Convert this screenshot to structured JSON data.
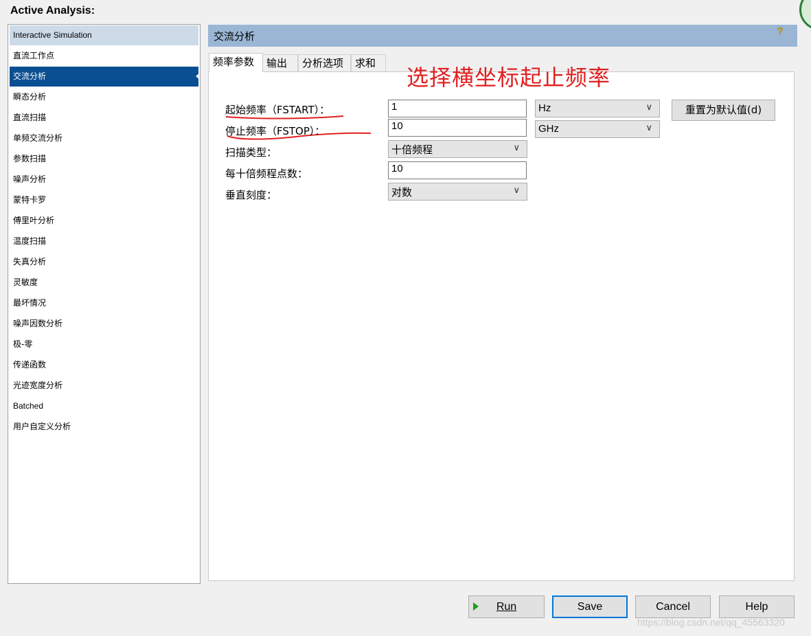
{
  "window": {
    "title": "Active Analysis:"
  },
  "sidebar": {
    "items": [
      {
        "label": "Interactive Simulation"
      },
      {
        "label": "直流工作点"
      },
      {
        "label": "交流分析"
      },
      {
        "label": "瞬态分析"
      },
      {
        "label": "直流扫描"
      },
      {
        "label": "单频交流分析"
      },
      {
        "label": "参数扫描"
      },
      {
        "label": "噪声分析"
      },
      {
        "label": "蒙特卡罗"
      },
      {
        "label": "傅里叶分析"
      },
      {
        "label": "温度扫描"
      },
      {
        "label": "失真分析"
      },
      {
        "label": "灵敏度"
      },
      {
        "label": "最坏情况"
      },
      {
        "label": "噪声因数分析"
      },
      {
        "label": "极-零"
      },
      {
        "label": "传递函数"
      },
      {
        "label": "光迹宽度分析"
      },
      {
        "label": "Batched"
      },
      {
        "label": "用户自定义分析"
      }
    ],
    "selected": "交流分析"
  },
  "panel": {
    "title": "交流分析",
    "help_icon": "?",
    "tabs": [
      {
        "label": "频率参数"
      },
      {
        "label": "输出"
      },
      {
        "label": "分析选项"
      },
      {
        "label": "求和"
      }
    ],
    "annotation": "选择横坐标起止频率",
    "fields": {
      "fstart": {
        "label": "起始频率（FSTART）：",
        "value": "1",
        "unit": "Hz"
      },
      "fstop": {
        "label": "停止频率（FSTOP）：",
        "value": "10",
        "unit": "GHz"
      },
      "sweep_type": {
        "label": "扫描类型：",
        "value": "十倍频程"
      },
      "points": {
        "label": "每十倍频程点数：",
        "value": "10"
      },
      "vscale": {
        "label": "垂直刻度：",
        "value": "对数"
      }
    },
    "reset_button": "重置为默认值(d)"
  },
  "footer": {
    "run": "Run",
    "save": "Save",
    "cancel": "Cancel",
    "help": "Help"
  },
  "watermark": "https://blog.csdn.net/qq_45563320",
  "colors": {
    "selection": "#0a4f92",
    "header": "#9bb6d4",
    "annotation": "#e02020",
    "run_icon": "#1f9e1f"
  }
}
